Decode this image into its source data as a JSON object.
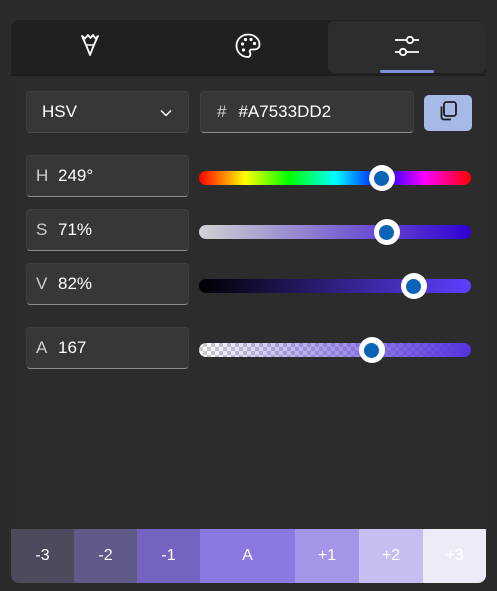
{
  "tabs": [
    {
      "icon": "eyedropper-icon"
    },
    {
      "icon": "palette-icon"
    },
    {
      "icon": "sliders-icon",
      "active": true
    }
  ],
  "mode_dropdown": {
    "value": "HSV",
    "icon": "chevron-down-icon"
  },
  "hex": {
    "prefix": "#",
    "value": "#A7533DD2"
  },
  "copy_button": {
    "icon": "copy-icon"
  },
  "channels": [
    {
      "label": "H",
      "value": "249°",
      "level": 0.69
    },
    {
      "label": "S",
      "value": "71%",
      "level": 0.71
    },
    {
      "label": "V",
      "value": "82%",
      "level": 0.82
    },
    {
      "label": "A",
      "value": "167",
      "level": 0.65
    }
  ],
  "swatches": [
    {
      "label": "-3",
      "color": "#4c4a5c"
    },
    {
      "label": "-2",
      "color": "#5f5a8a"
    },
    {
      "label": "-1",
      "color": "#7464c0"
    },
    {
      "label": "A",
      "color": "#8b78e0"
    },
    {
      "label": "+1",
      "color": "#a595e8"
    },
    {
      "label": "+2",
      "color": "#c6bdf0"
    },
    {
      "label": "+3",
      "color": "#eeebf8"
    }
  ],
  "colors": {
    "accent": "#7f91d6",
    "copy_button_bg": "#a7b9e7",
    "thumb_fill": "#0a63b4"
  }
}
